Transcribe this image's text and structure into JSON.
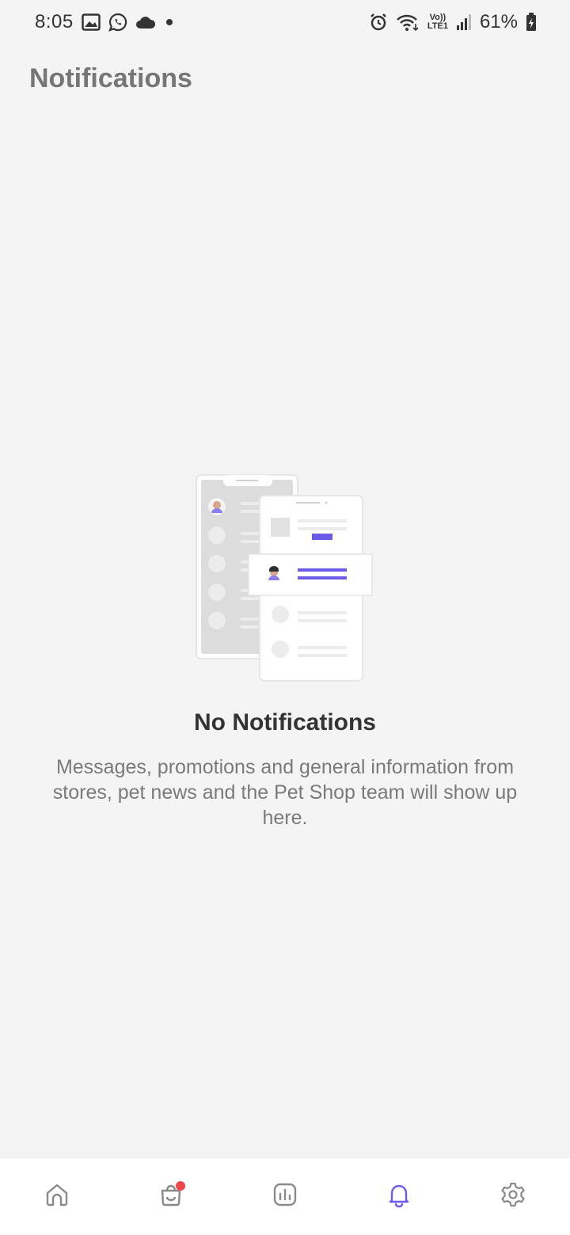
{
  "status_bar": {
    "time": "8:05",
    "battery": "61%",
    "icons_left": [
      "gallery-icon",
      "whatsapp-icon",
      "cloud-icon",
      "dot-icon"
    ],
    "icons_right": [
      "alarm-icon",
      "wifi-icon",
      "volte-icon",
      "signal-icon",
      "battery-icon"
    ],
    "volte_label_top": "Vo))",
    "volte_label_bottom": "LTE1"
  },
  "header": {
    "title": "Notifications"
  },
  "empty_state": {
    "title": "No Notifications",
    "description": "Messages, promotions and general information from stores, pet news and the Pet Shop team will show up here."
  },
  "bottom_nav": {
    "items": [
      {
        "icon": "home-icon",
        "active": false
      },
      {
        "icon": "shopping-bag-icon",
        "active": false,
        "badge": true
      },
      {
        "icon": "chart-icon",
        "active": false
      },
      {
        "icon": "bell-icon",
        "active": true
      },
      {
        "icon": "gear-icon",
        "active": false
      }
    ]
  },
  "colors": {
    "accent": "#6c5ce7",
    "badge": "#f0474f",
    "background": "#f4f4f5",
    "inactive_icon": "#8a8a8a"
  }
}
